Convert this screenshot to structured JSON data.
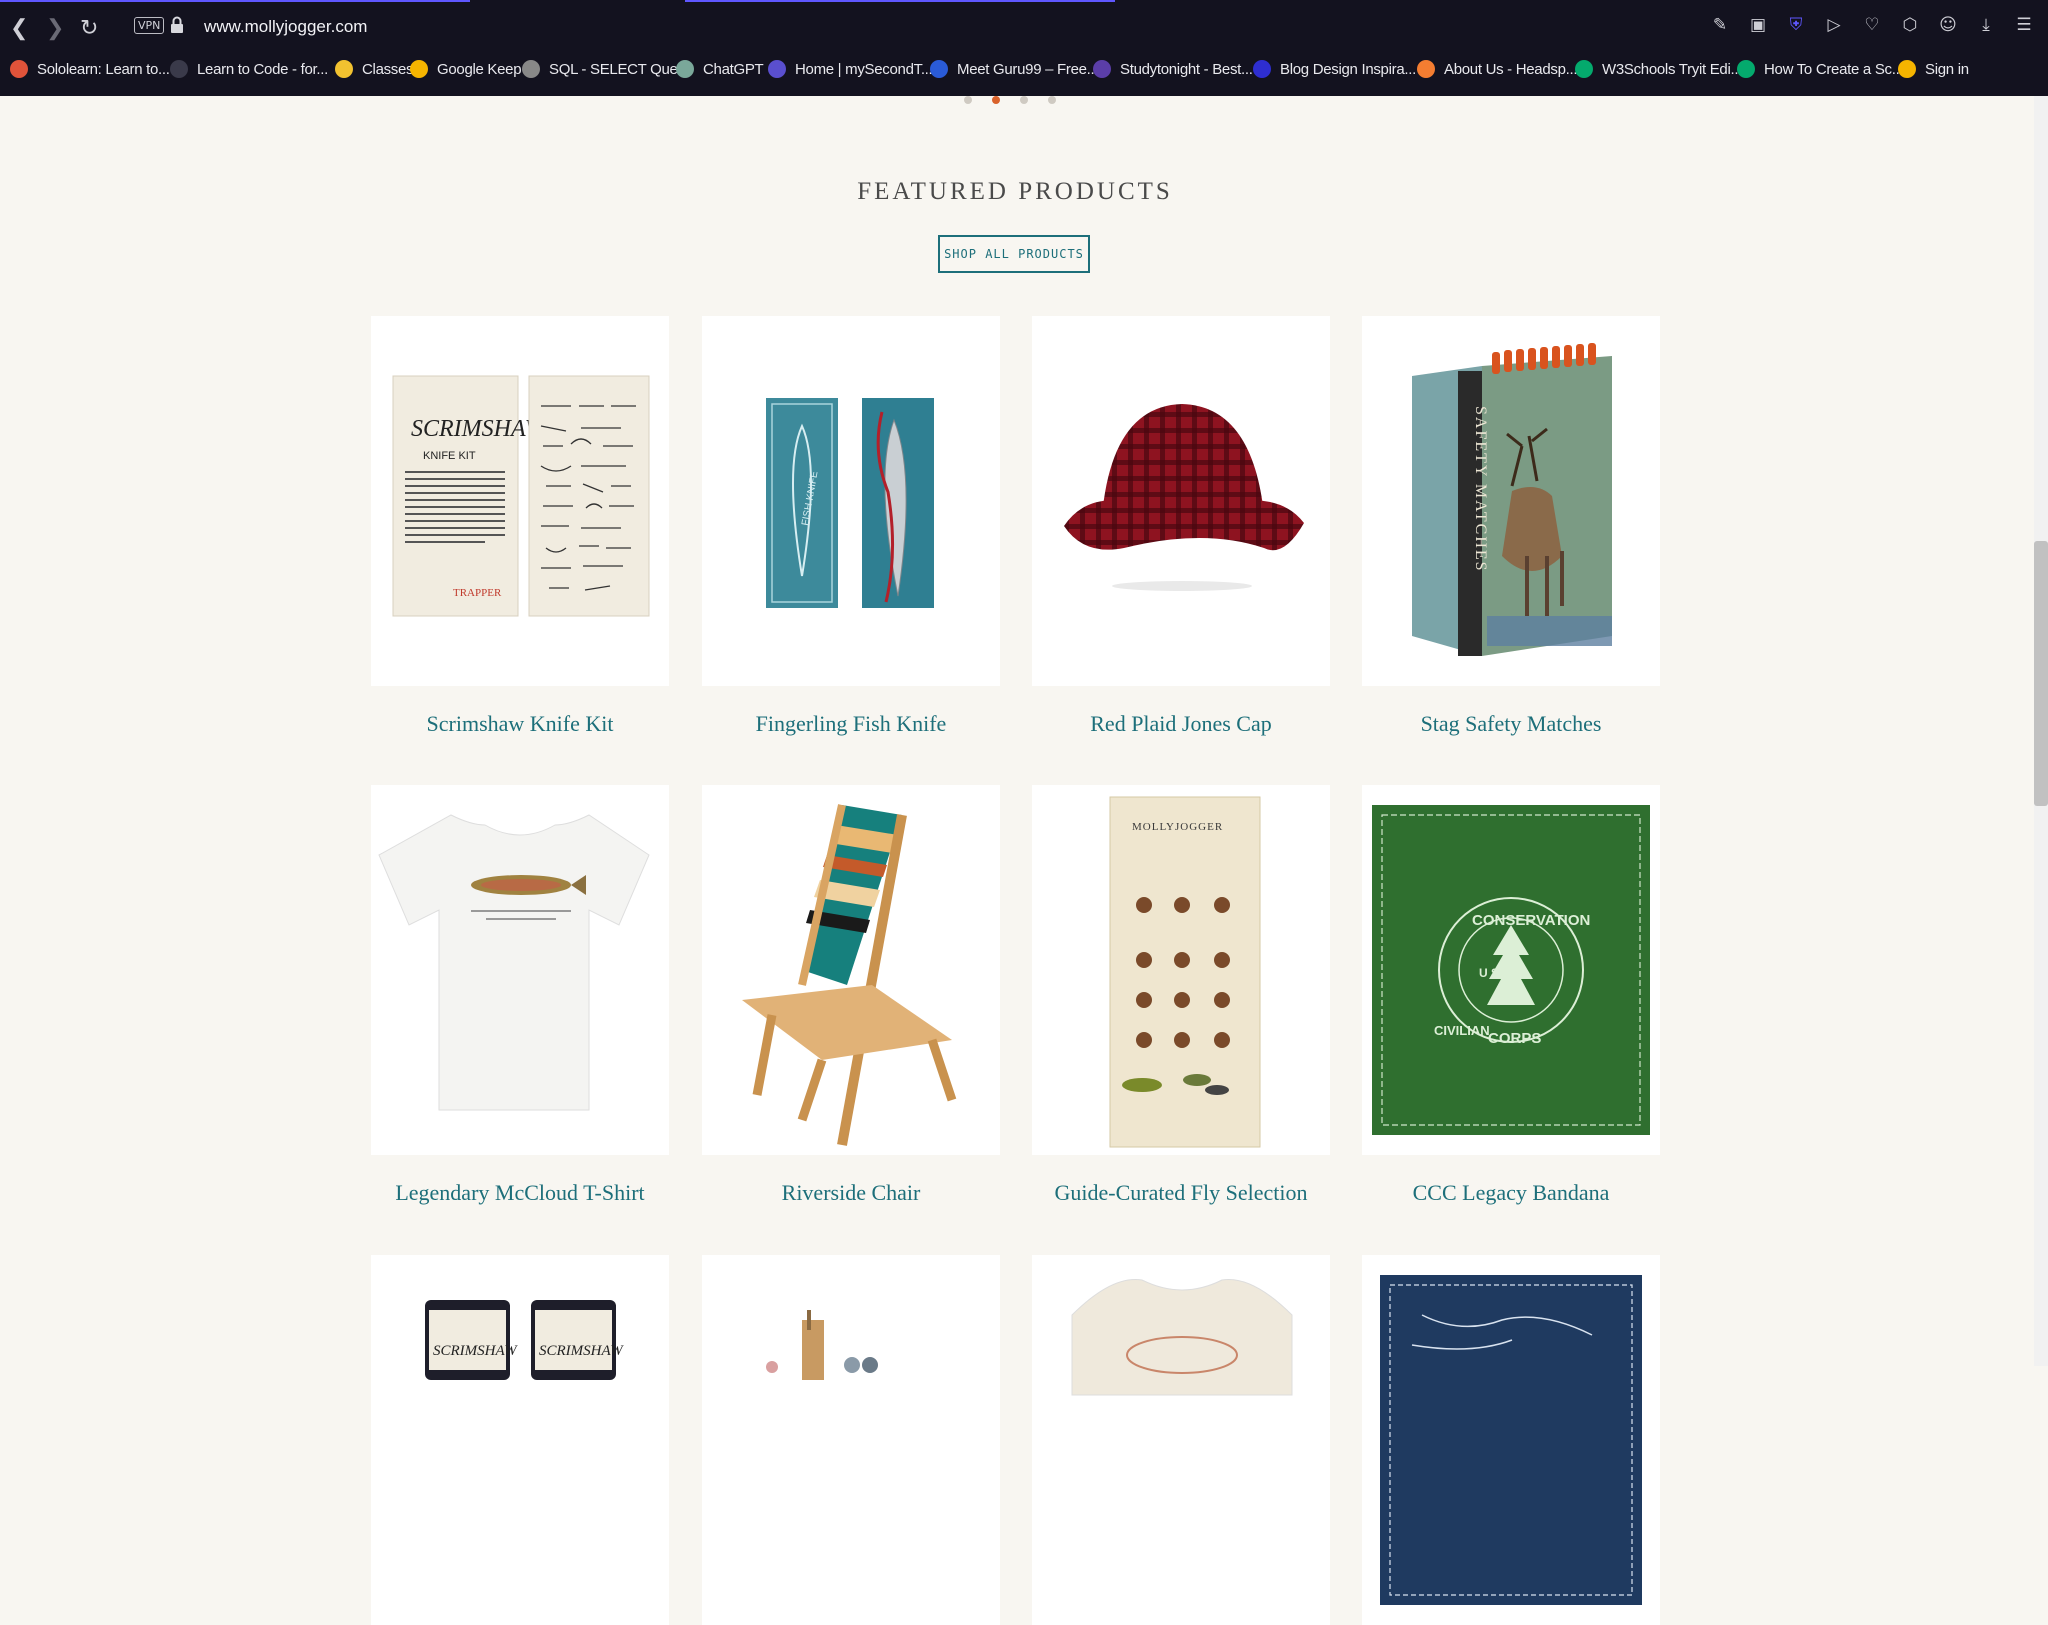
{
  "browser": {
    "url": "www.mollyjogger.com",
    "vpn_label": "VPN",
    "bookmarks": [
      {
        "label": "Sololearn: Learn to...",
        "icon": "sololearn-icon",
        "color": "#e0533a"
      },
      {
        "label": "Learn to Code - for...",
        "icon": "page-icon",
        "color": "#3a3a4a"
      },
      {
        "label": "Classes",
        "icon": "classroom-icon",
        "color": "#f2c230"
      },
      {
        "label": "Google Keep",
        "icon": "keep-icon",
        "color": "#f5b400"
      },
      {
        "label": "SQL - SELECT Query",
        "icon": "sql-icon",
        "color": "#888888"
      },
      {
        "label": "ChatGPT",
        "icon": "chatgpt-icon",
        "color": "#7aa89a"
      },
      {
        "label": "Home | mySecondT...",
        "icon": "site-icon",
        "color": "#5a4fcf"
      },
      {
        "label": "Meet Guru99 – Free...",
        "icon": "guru99-icon",
        "color": "#2a5bd7"
      },
      {
        "label": "Studytonight - Best...",
        "icon": "studytonight-icon",
        "color": "#5b3ea8"
      },
      {
        "label": "Blog Design Inspira...",
        "icon": "blog-icon",
        "color": "#2e2ed0"
      },
      {
        "label": "About Us - Headsp...",
        "icon": "headspace-icon",
        "color": "#f47d31"
      },
      {
        "label": "W3Schools Tryit Edi...",
        "icon": "w3schools-icon",
        "color": "#04aa6d"
      },
      {
        "label": "How To Create a Sc...",
        "icon": "w3schools-icon",
        "color": "#04aa6d"
      },
      {
        "label": "Sign in",
        "icon": "signin-icon",
        "color": "#f5b400"
      }
    ]
  },
  "section": {
    "heading": "FEATURED PRODUCTS",
    "button": "SHOP ALL PRODUCTS"
  },
  "products": [
    {
      "title": "Scrimshaw Knife Kit"
    },
    {
      "title": "Fingerling Fish Knife"
    },
    {
      "title": "Red Plaid Jones Cap"
    },
    {
      "title": "Stag Safety Matches"
    },
    {
      "title": "Legendary McCloud T-Shirt"
    },
    {
      "title": "Riverside Chair"
    },
    {
      "title": "Guide-Curated Fly Selection"
    },
    {
      "title": "CCC Legacy Bandana"
    }
  ],
  "image_text": {
    "scrimshaw": "SCRIMSHAW",
    "knife_kit": "KNIFE KIT",
    "trapper": "TRAPPER",
    "fish_knife": "FISH KNIFE",
    "safety_matches": "SAFETY MATCHES",
    "conservation": "CONSERVATION",
    "corps": "CORPS",
    "civilian": "CIVILIAN",
    "us_letters": "U    S",
    "mollyjogger": "MOLLYJOGGER"
  }
}
